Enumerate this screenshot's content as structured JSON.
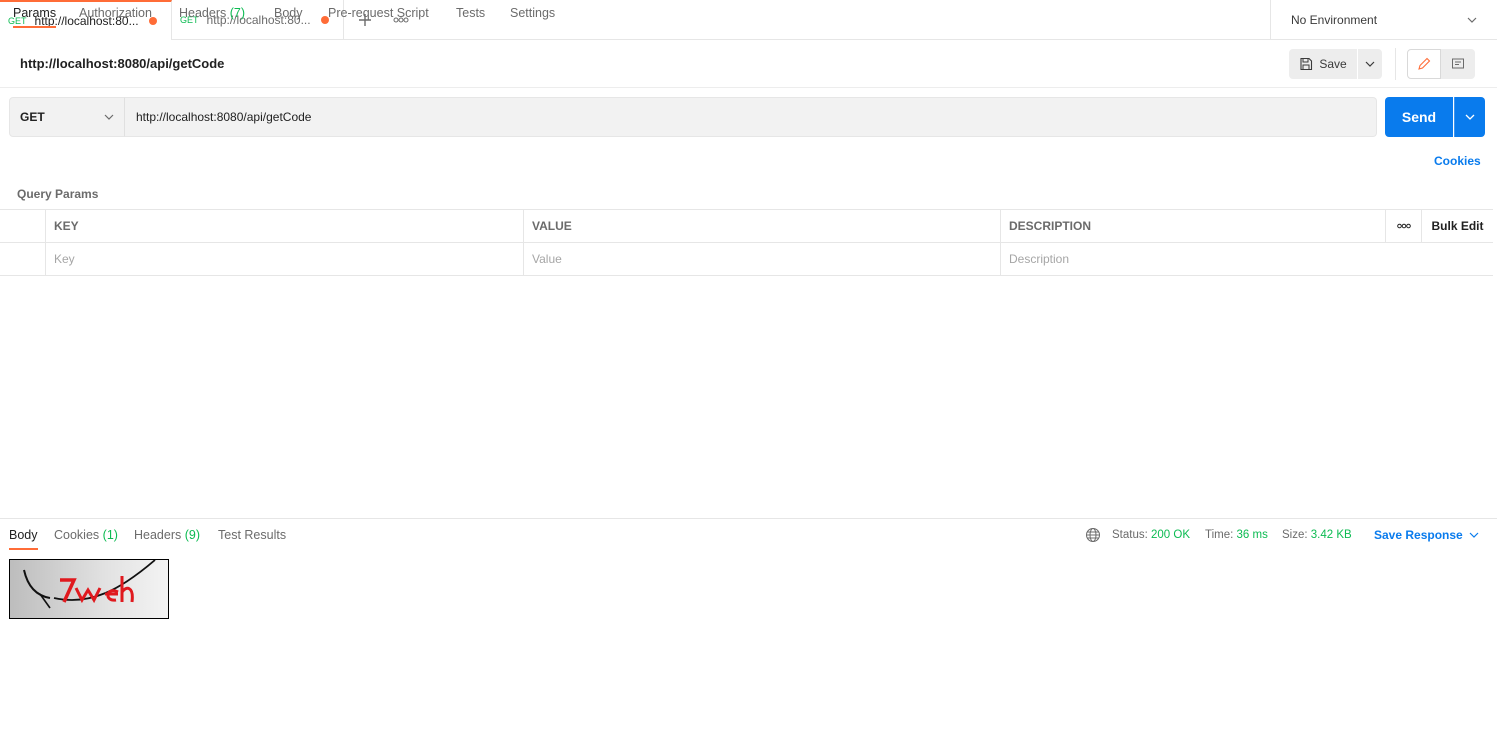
{
  "tabs": [
    {
      "method": "GET",
      "url": "http://localhost:80...",
      "active": true
    },
    {
      "method": "GET",
      "url": "http://localhost:80...",
      "active": false
    }
  ],
  "environment": {
    "label": "No Environment"
  },
  "request": {
    "title": "http://localhost:8080/api/getCode",
    "save_label": "Save",
    "method": "GET",
    "url": "http://localhost:8080/api/getCode",
    "send_label": "Send"
  },
  "request_tabs": {
    "params": "Params",
    "authorization": "Authorization",
    "headers": "Headers",
    "headers_count": "(7)",
    "body": "Body",
    "prerequest": "Pre-request Script",
    "tests": "Tests",
    "settings": "Settings",
    "cookies": "Cookies"
  },
  "params": {
    "section_label": "Query Params",
    "columns": {
      "key": "KEY",
      "value": "VALUE",
      "description": "DESCRIPTION"
    },
    "bulk_edit": "Bulk Edit",
    "placeholders": {
      "key": "Key",
      "value": "Value",
      "description": "Description"
    }
  },
  "response": {
    "tabs": {
      "body": "Body",
      "cookies": "Cookies",
      "cookies_count": "(1)",
      "headers": "Headers",
      "headers_count": "(9)",
      "tests": "Test Results"
    },
    "status_label": "Status:",
    "status_value": "200 OK",
    "time_label": "Time:",
    "time_value": "36 ms",
    "size_label": "Size:",
    "size_value": "3.42 KB",
    "save_response": "Save Response"
  },
  "colors": {
    "accent": "#ff6c37",
    "primary": "#097bed",
    "success": "#0cbb52"
  }
}
